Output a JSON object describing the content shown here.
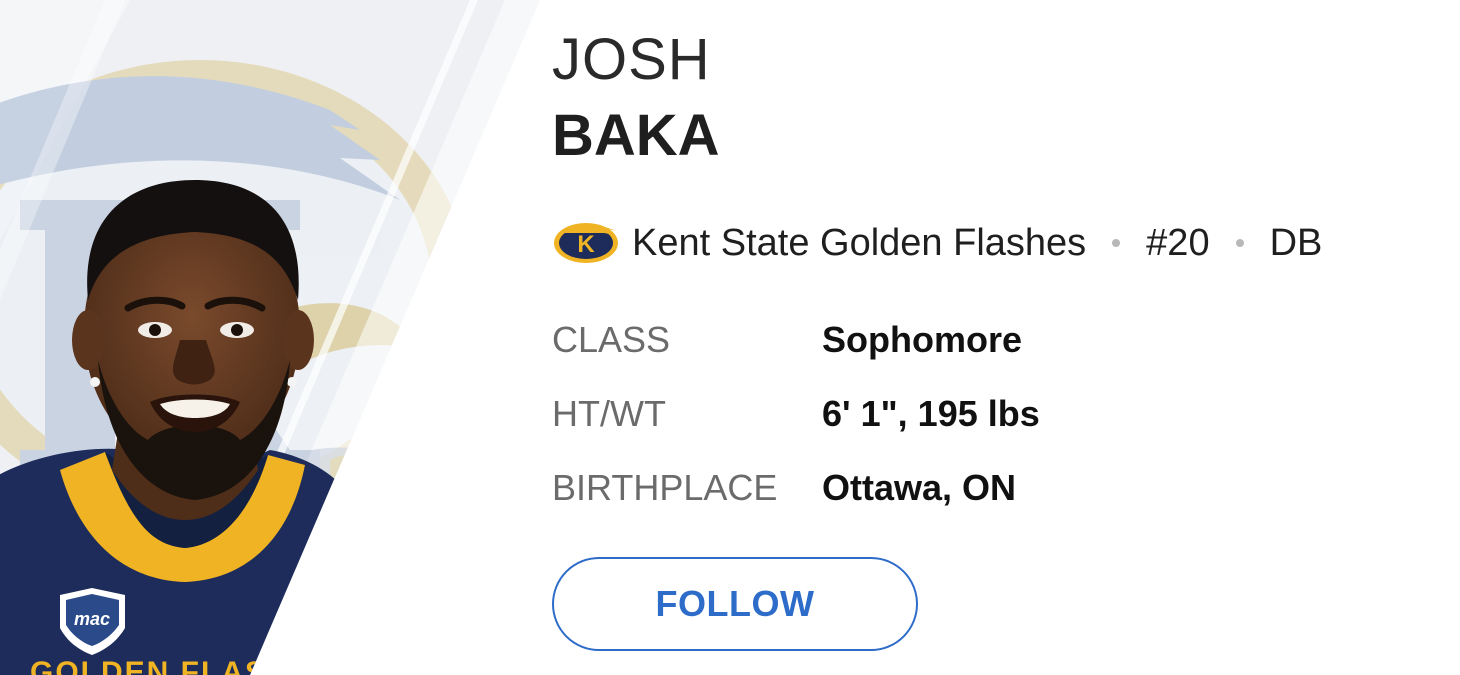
{
  "player": {
    "first_name": "JOSH",
    "last_name": "BAKA",
    "team": "Kent State Golden Flashes",
    "number": "#20",
    "position": "DB"
  },
  "team_logo_icon": "kent-state-team-logo-icon",
  "details": [
    {
      "label": "CLASS",
      "value": "Sophomore"
    },
    {
      "label": "HT/WT",
      "value": "6' 1\", 195 lbs"
    },
    {
      "label": "BIRTHPLACE",
      "value": "Ottawa, ON"
    }
  ],
  "actions": {
    "follow_label": "FOLLOW"
  },
  "jersey_text": "GOLDEN FLASHES",
  "colors": {
    "accent": "#2d6cc8",
    "team_navy": "#1d2c5a",
    "team_gold": "#f0b323",
    "label_gray": "#6b6b6b"
  }
}
